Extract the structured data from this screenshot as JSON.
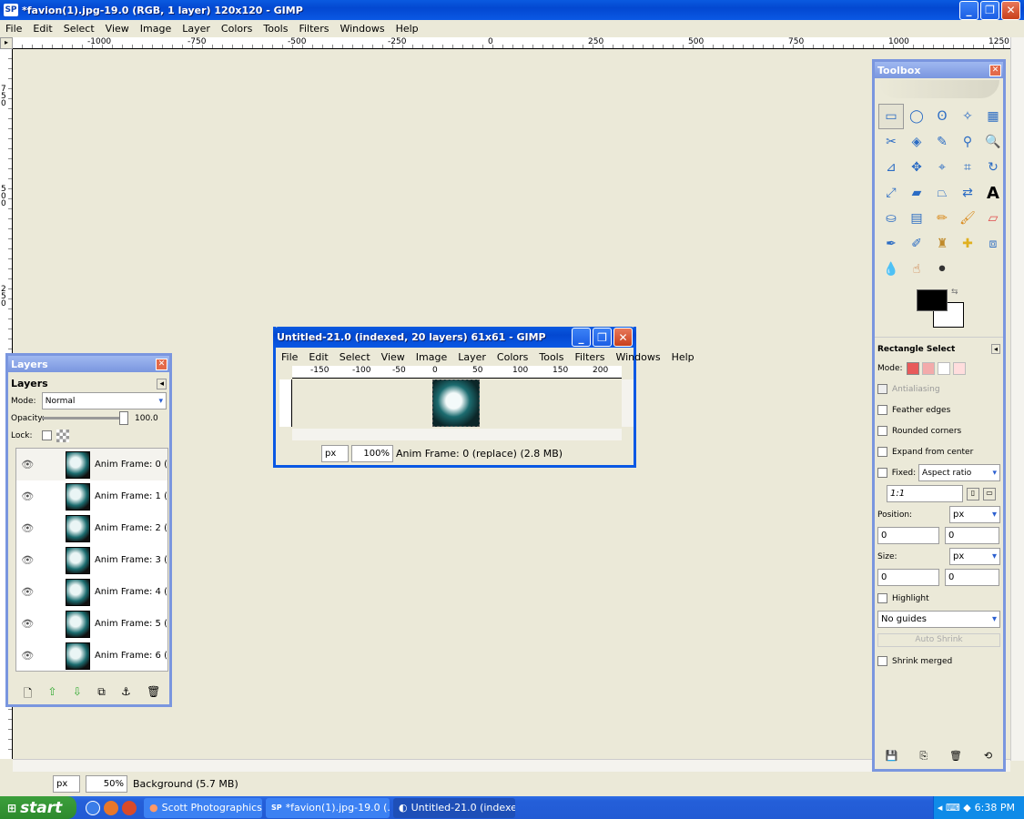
{
  "main": {
    "title": "*favion(1).jpg-19.0 (RGB, 1 layer) 120x120 - GIMP",
    "app_icon": "SP",
    "menu": [
      "File",
      "Edit",
      "Select",
      "View",
      "Image",
      "Layer",
      "Colors",
      "Tools",
      "Filters",
      "Windows",
      "Help"
    ],
    "hruler_ticks": [
      "-1000",
      "-750",
      "-500",
      "-250",
      "0",
      "250",
      "500",
      "750",
      "1000",
      "1250"
    ],
    "vruler_ticks": [
      "750",
      "500",
      "250"
    ],
    "status": {
      "unit": "px",
      "zoom": "50%",
      "text": "Background (5.7 MB)"
    }
  },
  "layers": {
    "title": "Layers",
    "section": "Layers",
    "mode_label": "Mode:",
    "mode_value": "Normal",
    "opacity_label": "Opacity:",
    "opacity_value": "100.0",
    "lock_label": "Lock:",
    "items": [
      "Anim Frame: 0 (",
      "Anim Frame: 1 (",
      "Anim Frame: 2 (",
      "Anim Frame: 3 (",
      "Anim Frame: 4 (",
      "Anim Frame: 5 (",
      "Anim Frame: 6 ("
    ]
  },
  "subwin": {
    "title": "Untitled-21.0 (indexed, 20 layers) 61x61 - GIMP",
    "menu": [
      "File",
      "Edit",
      "Select",
      "View",
      "Image",
      "Layer",
      "Colors",
      "Tools",
      "Filters",
      "Windows",
      "Help"
    ],
    "ruler_ticks": [
      "-150",
      "-100",
      "-50",
      "0",
      "50",
      "100",
      "150",
      "200"
    ],
    "status": {
      "unit": "px",
      "zoom": "100%",
      "text": "Anim Frame: 0 (replace) (2.8 MB)"
    }
  },
  "toolbox": {
    "title": "Toolbox",
    "options_title": "Rectangle Select",
    "mode_label": "Mode:",
    "antialiasing": "Antialiasing",
    "feather": "Feather edges",
    "rounded": "Rounded corners",
    "expand": "Expand from center",
    "fixed": "Fixed:",
    "fixed_value": "Aspect ratio",
    "ratio": "1:1",
    "position_label": "Position:",
    "position_unit": "px",
    "pos_x": "0",
    "pos_y": "0",
    "size_label": "Size:",
    "size_unit": "px",
    "size_x": "0",
    "size_y": "0",
    "highlight": "Highlight",
    "guides": "No guides",
    "auto_shrink": "Auto Shrink",
    "shrink_merged": "Shrink merged",
    "fg_color": "#000000",
    "bg_color": "#ffffff"
  },
  "taskbar": {
    "start": "start",
    "tasks": [
      "Scott Photographics |...",
      "*favion(1).jpg-19.0 (...",
      "Untitled-21.0 (indexe..."
    ],
    "time": "6:38 PM"
  }
}
